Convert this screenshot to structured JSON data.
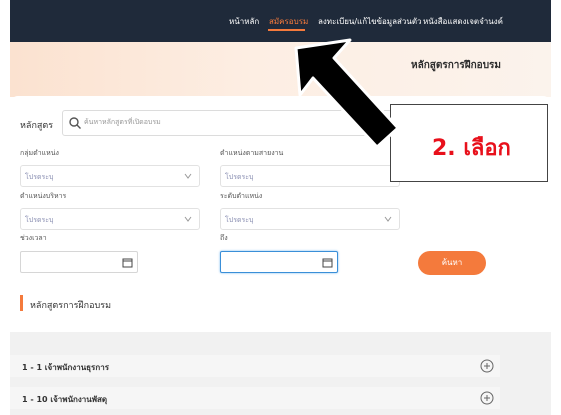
{
  "nav": {
    "items": [
      "หน้าหลัก",
      "สมัครอบรม",
      "ลงทะเบียน/แก้ไขข้อมูลส่วนตัว",
      "หนังสือแสดงเจตจำนงค์"
    ],
    "active_index": 1
  },
  "hero": {
    "title": "หลักสูตรการฝึกอบรม"
  },
  "search": {
    "label": "หลักสูตร",
    "placeholder": "ค้นหาหลักสูตรที่เปิดอบรม"
  },
  "filters": {
    "group_label": "กลุ่มตำแหน่ง",
    "group_value": "โปรดระบุ",
    "line_label": "ตำแหน่งตามสายงาน",
    "line_value": "โปรดระบุ",
    "admin_label": "ตำแหน่งบริหาร",
    "admin_value": "โปรดระบุ",
    "level_label": "ระดับตำแหน่ง",
    "level_value": "โปรดระบุ",
    "period_label": "ช่วงเวลา",
    "to_label": "ถึง",
    "search_button": "ค้นหา"
  },
  "section": {
    "title": "หลักสูตรการฝึกอบรม"
  },
  "courses": [
    {
      "label": "1 - 1 เจ้าพนักงานธุรการ"
    },
    {
      "label": "1 - 10 เจ้าพนักงานพัสดุ"
    }
  ],
  "annotation": {
    "text": "2. เลือก"
  },
  "colors": {
    "accent": "#f47a3c",
    "navbar": "#1f2a3a",
    "callout_text": "#e8101b"
  }
}
